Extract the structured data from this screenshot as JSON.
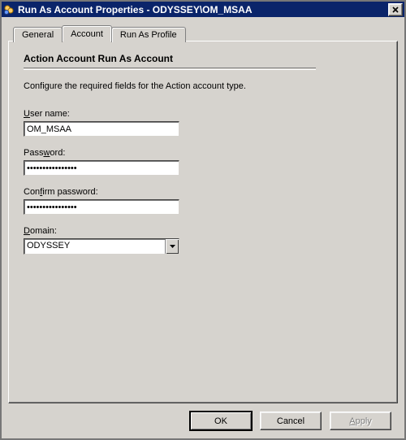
{
  "window": {
    "title": "Run As Account Properties - ODYSSEY\\OM_MSAA"
  },
  "tabs": {
    "general": "General",
    "account": "Account",
    "runas": "Run As Profile"
  },
  "section": {
    "title": "Action Account Run As Account",
    "description": "Configure the required fields for the Action account type."
  },
  "fields": {
    "username_label_pre": "",
    "username_label_u": "U",
    "username_label_post": "ser name:",
    "username_value": "OM_MSAA",
    "password_label_pre": "Pass",
    "password_label_u": "w",
    "password_label_post": "ord:",
    "password_value": "••••••••••••••••",
    "confirm_label_pre": "Con",
    "confirm_label_u": "f",
    "confirm_label_post": "irm password:",
    "confirm_value": "••••••••••••••••",
    "domain_label_pre": "",
    "domain_label_u": "D",
    "domain_label_post": "omain:",
    "domain_value": "ODYSSEY"
  },
  "buttons": {
    "ok": "OK",
    "cancel": "Cancel",
    "apply_u": "A",
    "apply_post": "pply"
  }
}
